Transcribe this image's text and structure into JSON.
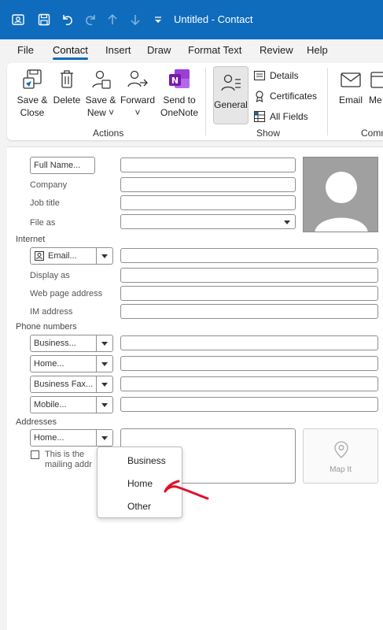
{
  "window": {
    "title": "Untitled  -  Contact"
  },
  "menu": {
    "tabs": [
      "File",
      "Contact",
      "Insert",
      "Draw",
      "Format Text",
      "Review",
      "Help"
    ],
    "active": "Contact"
  },
  "ribbon": {
    "actions": {
      "save_close": [
        "Save &",
        "Close"
      ],
      "delete": "Delete",
      "save_new": [
        "Save &",
        "New ˅"
      ],
      "forward": [
        "Forward",
        "˅"
      ],
      "send_onenote": [
        "Send to",
        "OneNote"
      ],
      "label": "Actions"
    },
    "show": {
      "general": "General",
      "details": "Details",
      "certificates": "Certificates",
      "all_fields": "All Fields",
      "label": "Show"
    },
    "comm": {
      "email": "Email",
      "more": "Me",
      "label": "Comm"
    }
  },
  "form": {
    "full_name_button": "Full Name...",
    "company": "Company",
    "job_title": "Job title",
    "file_as": "File as",
    "internet_section": "Internet",
    "email_dropdown": "Email...",
    "display_as": "Display as",
    "web_page": "Web page address",
    "im_address": "IM address",
    "phone_section": "Phone numbers",
    "phone_business": "Business...",
    "phone_home": "Home...",
    "phone_business_fax": "Business Fax...",
    "phone_mobile": "Mobile...",
    "addresses_section": "Addresses",
    "address_type": "Home...",
    "mailing_line1": "This is the",
    "mailing_line2": "mailing addr",
    "map_it": "Map It"
  },
  "popup": {
    "options": [
      "Business",
      "Home",
      "Other"
    ]
  },
  "colors": {
    "accent": "#0f6cbd",
    "annotation": "#e0102a"
  }
}
